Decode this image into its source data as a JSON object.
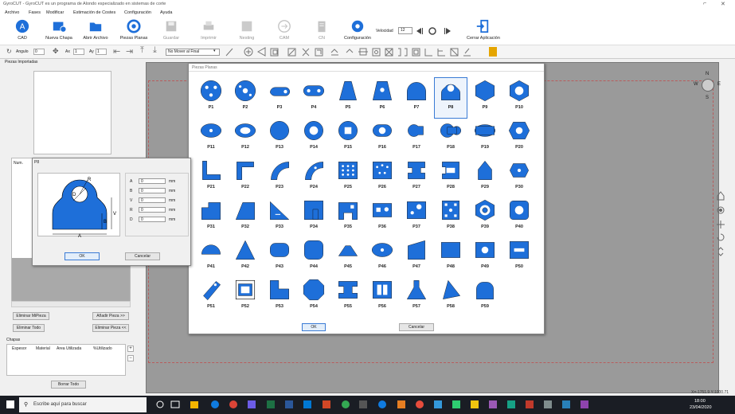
{
  "app": {
    "title": "GyroCUT - GyroCUT es un programa de Alondo especializado en sistemas de corte"
  },
  "menu": [
    "Archivo",
    "Fases",
    "Modificar",
    "Estimación de Costes",
    "Configuración",
    "Ayuda"
  ],
  "ribbon": {
    "cad": "CAD",
    "nueva": "Nueva Chapa",
    "abrir": "Abrir Archivo",
    "piezas": "Piezas Planas",
    "guardar": "Guardar",
    "imprimir": "Imprimir",
    "nesting": "Nesting",
    "cam": "CAM",
    "cn": "CN",
    "config": "Configuración",
    "velocidad_label": "Velocidad",
    "velocidad_value": "12",
    "cerrar": "Cerrar Aplicación"
  },
  "toolbar": {
    "angulo_label": "Angulo",
    "angulo_value": "0",
    "ax_label": "Ax",
    "ax_value": "1",
    "ay_label": "Ay",
    "ay_value": "1",
    "mode": "No Mover al Final"
  },
  "left": {
    "piezas_importadas": "Piezas Importadas",
    "num_header": "Num.",
    "eliminar_mipieza": "Eliminar MiPieza",
    "anadir_pieza": "Añadir Pieza >>",
    "eliminar_todo": "Eliminar Todo",
    "eliminar_pieza": "Eliminar Pieza <<",
    "chapas": "Chapas",
    "cols": [
      "Espesor",
      "Material",
      "Area Utilizada",
      "%Utilizado"
    ],
    "borrar_todo": "Borrar Todo"
  },
  "piezas_dialog": {
    "title": "Piezas Planas",
    "ok": "OK",
    "cancel": "Cancelar",
    "items": [
      "P1",
      "P2",
      "P3",
      "P4",
      "P5",
      "P6",
      "P7",
      "P8",
      "P9",
      "P10",
      "P11",
      "P12",
      "P13",
      "P14",
      "P15",
      "P16",
      "P17",
      "P18",
      "P19",
      "P20",
      "P21",
      "P22",
      "P23",
      "P24",
      "P25",
      "P26",
      "P27",
      "P28",
      "P29",
      "P30",
      "P31",
      "P32",
      "P33",
      "P34",
      "P35",
      "P36",
      "P37",
      "P38",
      "P39",
      "P40",
      "P41",
      "P42",
      "P43",
      "P44",
      "P45",
      "P46",
      "P47",
      "P48",
      "P49",
      "P50",
      "P51",
      "P52",
      "P53",
      "P54",
      "P55",
      "P56",
      "P57",
      "P58",
      "P59"
    ]
  },
  "param_dialog": {
    "title": "P8",
    "labels": [
      "A",
      "B",
      "V",
      "R",
      "D"
    ],
    "values": [
      "0",
      "0",
      "0",
      "0",
      "0"
    ],
    "unit": "mm",
    "ok": "OK",
    "cancel": "Cancelar",
    "drawing_labels": [
      "R",
      "D",
      "V",
      "B",
      "A"
    ]
  },
  "compass": {
    "n": "N",
    "s": "S",
    "e": "E",
    "w": "W"
  },
  "status": {
    "coords": "X=-1751.9 Y:1000.71"
  },
  "taskbar": {
    "search": "Escribe aquí para buscar",
    "time": "18:00",
    "date": "23/04/2020"
  },
  "colors": {
    "piece_blue": "#1e6fd9",
    "accent": "#1e6fd9"
  }
}
